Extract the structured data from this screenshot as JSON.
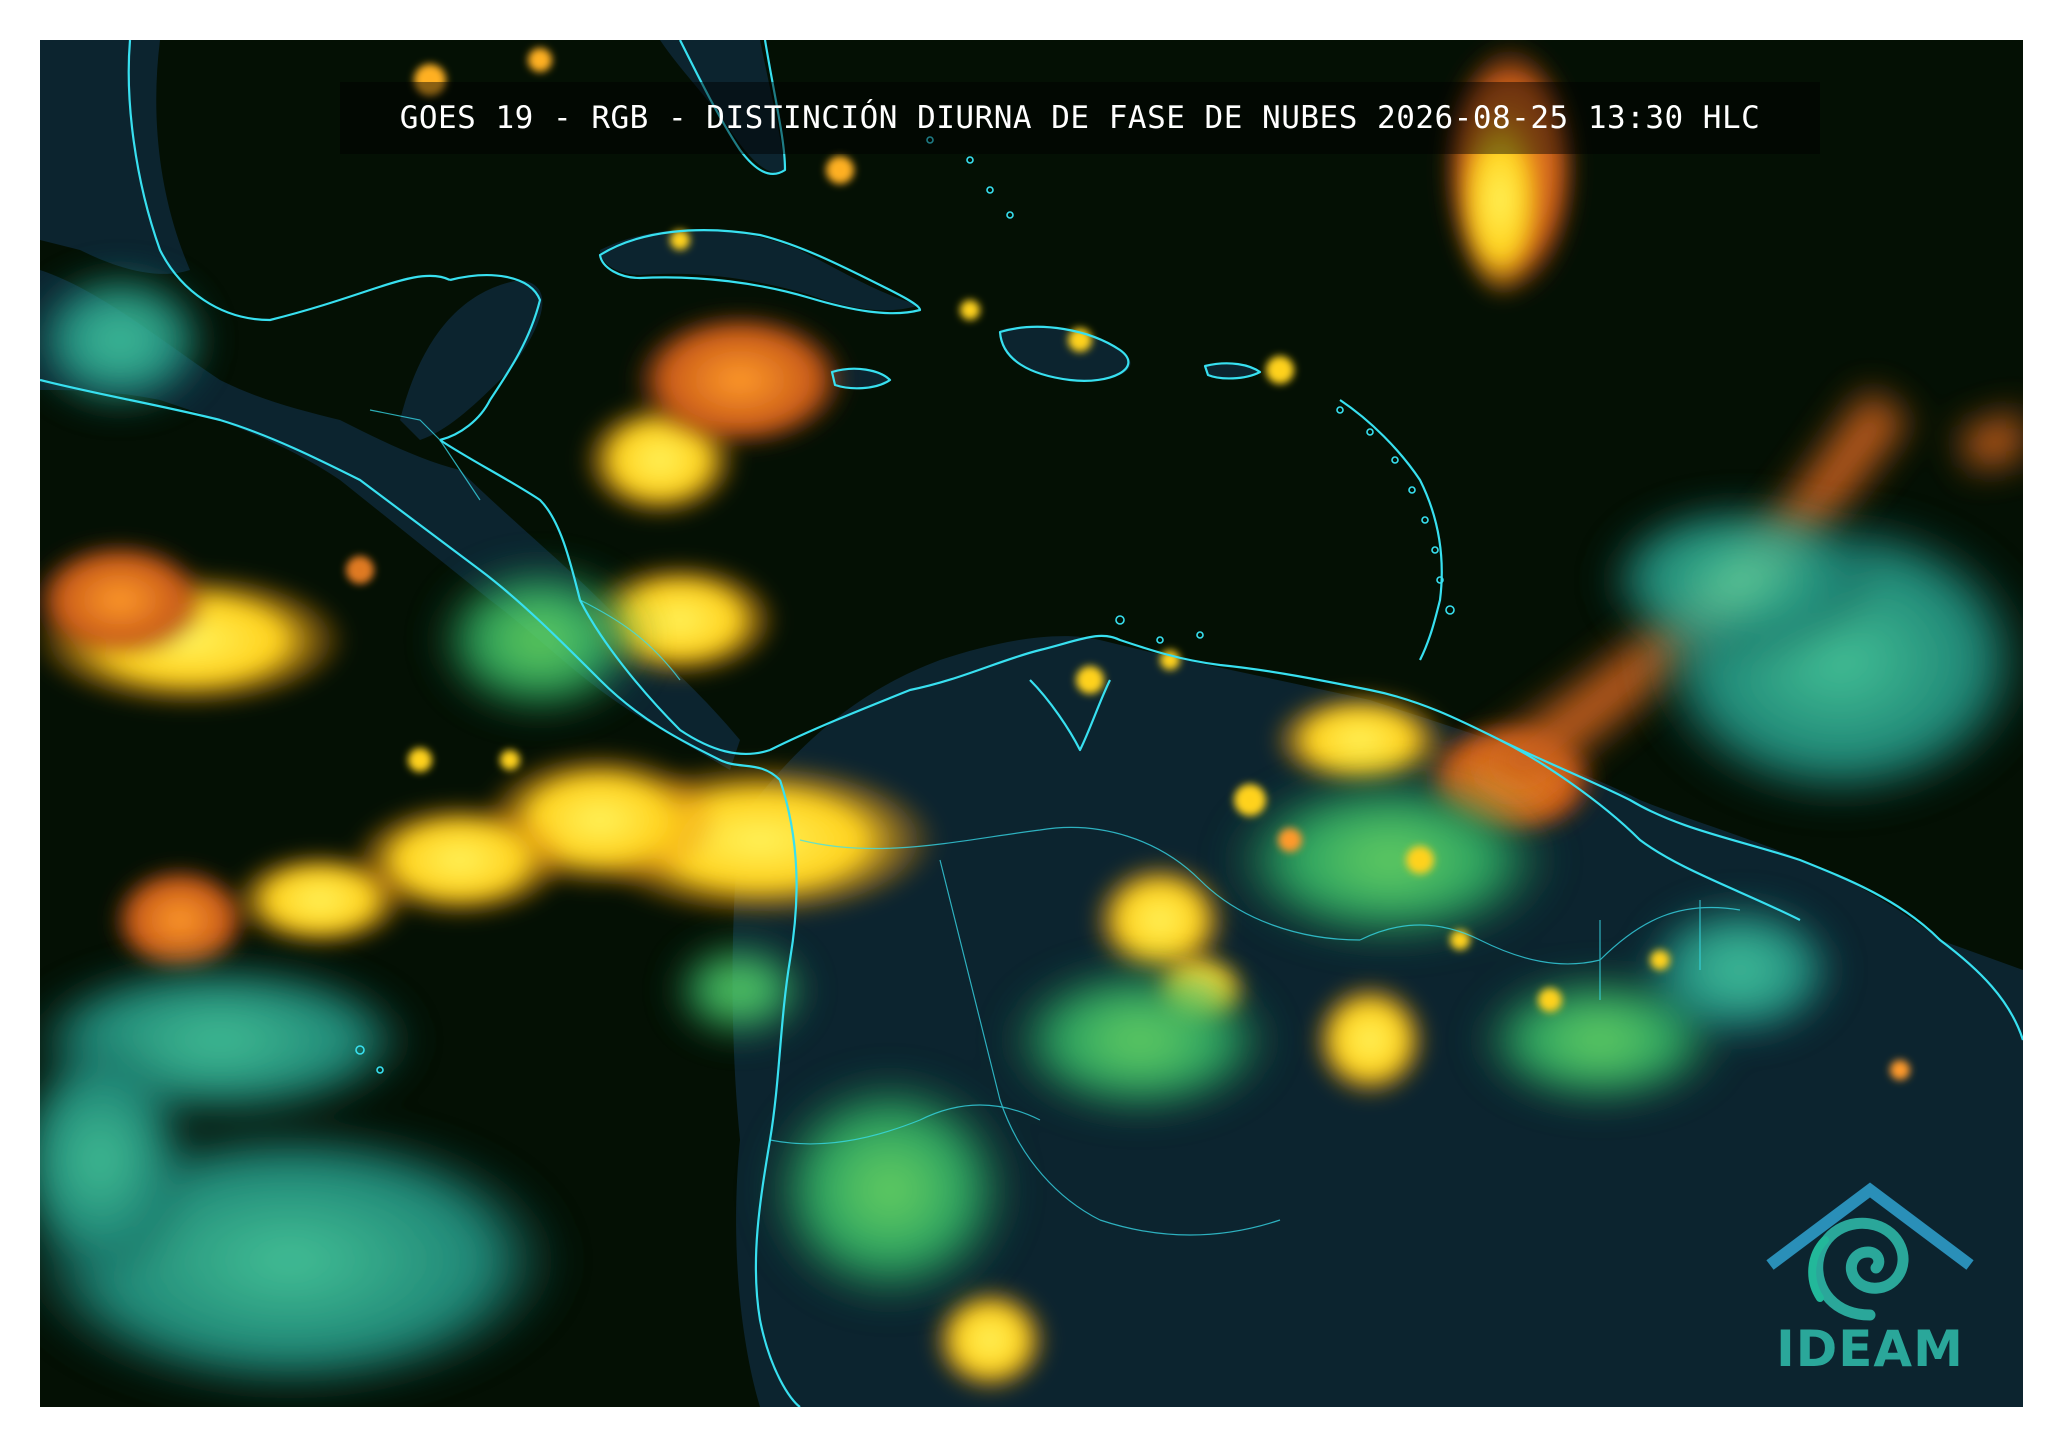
{
  "title": "GOES 19 - RGB - DISTINCIÓN DIURNA DE FASE DE NUBES 2026-08-25 13:30 HLC",
  "logo": {
    "text": "IDEAM",
    "color": "#2aa79a"
  },
  "colors": {
    "background": "#041004",
    "land": "#0c2430",
    "coastline": "#38e0f0",
    "ice_cloud": "#ffe020",
    "ice_cloud_core": "#ff8c1a",
    "water_cloud": "#38d890",
    "low_cloud": "#2fb8a0"
  },
  "icons": {
    "logo_icon": "ideam-swirl-house-icon"
  }
}
